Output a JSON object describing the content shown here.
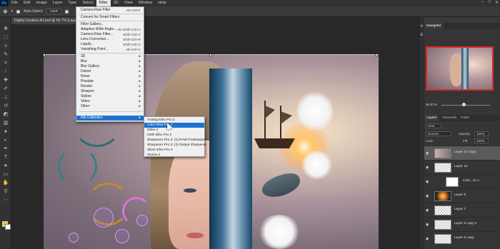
{
  "app": {
    "logo": "Ps"
  },
  "menubar": {
    "items": [
      "File",
      "Edit",
      "Image",
      "Layer",
      "Type",
      "Select",
      "Filter",
      "3D",
      "View",
      "Window",
      "Help"
    ],
    "active": "Filter",
    "window_controls": [
      "–",
      "□",
      "✕"
    ]
  },
  "options_bar": {
    "auto_select_label": "Auto-Select:",
    "auto_select_value": "Layer"
  },
  "document_tab": {
    "title": "Digital Creative Art.psd @ 66.7% (Layer 12 copy, RGB/8) *"
  },
  "filter_menu": {
    "items": [
      {
        "label": "Camera Raw Filter",
        "shortcut": "Alt+Ctrl+F"
      },
      {
        "label": "Convert for Smart Filters",
        "shortcut": ""
      },
      {
        "label": "Filter Gallery...",
        "shortcut": ""
      },
      {
        "label": "Adaptive Wide Angle...",
        "shortcut": "Alt+Shift+Ctrl+A"
      },
      {
        "label": "Camera Raw Filter...",
        "shortcut": "Shift+Ctrl+A"
      },
      {
        "label": "Lens Correction...",
        "shortcut": "Shift+Ctrl+R"
      },
      {
        "label": "Liquify...",
        "shortcut": "Shift+Ctrl+X"
      },
      {
        "label": "Vanishing Point...",
        "shortcut": "Alt+Ctrl+V"
      },
      {
        "label": "3D",
        "shortcut": ""
      },
      {
        "label": "Blur",
        "shortcut": ""
      },
      {
        "label": "Blur Gallery",
        "shortcut": ""
      },
      {
        "label": "Distort",
        "shortcut": ""
      },
      {
        "label": "Noise",
        "shortcut": ""
      },
      {
        "label": "Pixelate",
        "shortcut": ""
      },
      {
        "label": "Render",
        "shortcut": ""
      },
      {
        "label": "Sharpen",
        "shortcut": ""
      },
      {
        "label": "Stylize",
        "shortcut": ""
      },
      {
        "label": "Video",
        "shortcut": ""
      },
      {
        "label": "Other",
        "shortcut": ""
      },
      {
        "label": "Nik Collection",
        "shortcut": ""
      }
    ]
  },
  "nik_submenu": {
    "items": [
      "Analog Efex Pro 2",
      "Color Efex Pro 4",
      "Dfine 2",
      "HDR Efex Pro 2",
      "Sharpener Pro 3: (1) RAW Presharpener",
      "Sharpener Pro 3: (2) Output Sharpener",
      "Silver Efex Pro 2",
      "Viveza 2"
    ],
    "highlighted": "Color Efex Pro 4"
  },
  "navigator": {
    "tab_label": "Navigator",
    "zoom": "66.67%"
  },
  "layers_panel": {
    "tabs": [
      "Layers",
      "Channels",
      "Paths"
    ],
    "kind_filter": "Kind",
    "blend_mode": "Normal",
    "opacity_label": "Opacity:",
    "opacity_value": "100%",
    "lock_label": "Lock:",
    "fill_label": "Fill:",
    "fill_value": "100%",
    "layers": [
      {
        "name": "Layer 12 copy",
        "selected": true
      },
      {
        "name": "Layer 12",
        "selected": false
      },
      {
        "name": "Colo...ce 1",
        "selected": false
      },
      {
        "name": "Layer 9",
        "selected": false
      },
      {
        "name": "Layer 7",
        "selected": false
      },
      {
        "name": "Layer 5 copy 2",
        "selected": false
      },
      {
        "name": "Layer 5 copy",
        "selected": false
      }
    ]
  },
  "colors": {
    "accent": "#1e72cf",
    "fg_swatch": "#f5c518",
    "bg_swatch": "#ffffff",
    "panel": "#3a3a3a"
  }
}
